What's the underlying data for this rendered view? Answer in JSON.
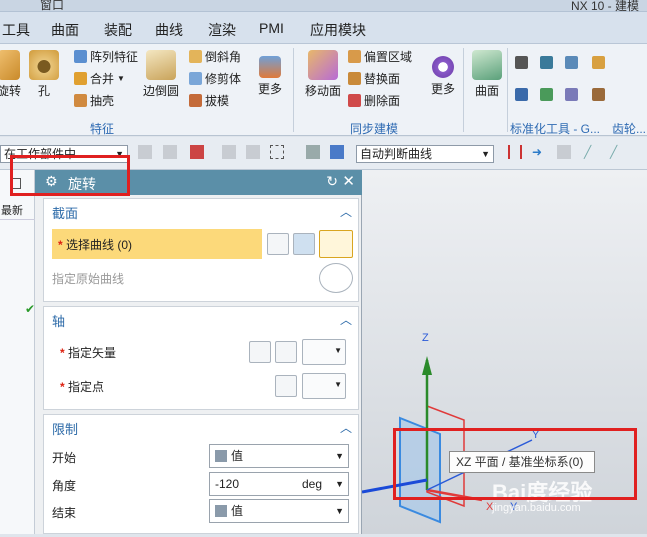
{
  "window": {
    "doc_tab": "窗口",
    "app_title": "NX 10 - 建模"
  },
  "menu": [
    "工具",
    "曲面",
    "装配",
    "曲线",
    "渲染",
    "PMI",
    "应用模块"
  ],
  "ribbon": {
    "rotate_label": "旋转",
    "hole_label": "孔",
    "pattern_feature": "阵列特征",
    "combine": "合并",
    "shell": "抽壳",
    "edge_blend": "边倒圆",
    "chamfer": "倒斜角",
    "trim_body": "修剪体",
    "draft": "拔模",
    "more1": "更多",
    "group_feature": "特征",
    "move_face": "移动面",
    "offset_region": "偏置区域",
    "replace_face": "替换面",
    "delete_face": "删除面",
    "more2": "更多",
    "group_sync": "同步建模",
    "surface": "曲面",
    "group_std_tools": "标准化工具 - G...",
    "group_gear": "齿轮..."
  },
  "toolbar2": {
    "scope_combo": "在工作部件中",
    "curve_rule_combo": "自动判断曲线"
  },
  "leftstrip": {
    "header": "最新"
  },
  "dialog": {
    "title": "旋转",
    "section_label": "截面",
    "select_curve": "选择曲线 (0)",
    "specify_origin_curve": "指定原始曲线",
    "axis_label": "轴",
    "specify_vector": "指定矢量",
    "specify_point": "指定点",
    "limits_label": "限制",
    "start_label": "开始",
    "start_value": "值",
    "angle_label": "角度",
    "angle_value": "-120",
    "angle_unit": "deg",
    "end_label": "结束",
    "end_value": "值"
  },
  "viewport": {
    "axis_z": "Z",
    "axis_y": "Y",
    "axis_x": "X",
    "axis_y2": "Y",
    "tooltip": "XZ 平面 / 基准坐标系(0)",
    "watermark": "Bai度经验",
    "watermark_url": "jingyan.baidu.com"
  },
  "colors": {
    "dialog_header": "#5b8fa8",
    "highlight": "#fcd97a",
    "annotation": "#e02020"
  }
}
